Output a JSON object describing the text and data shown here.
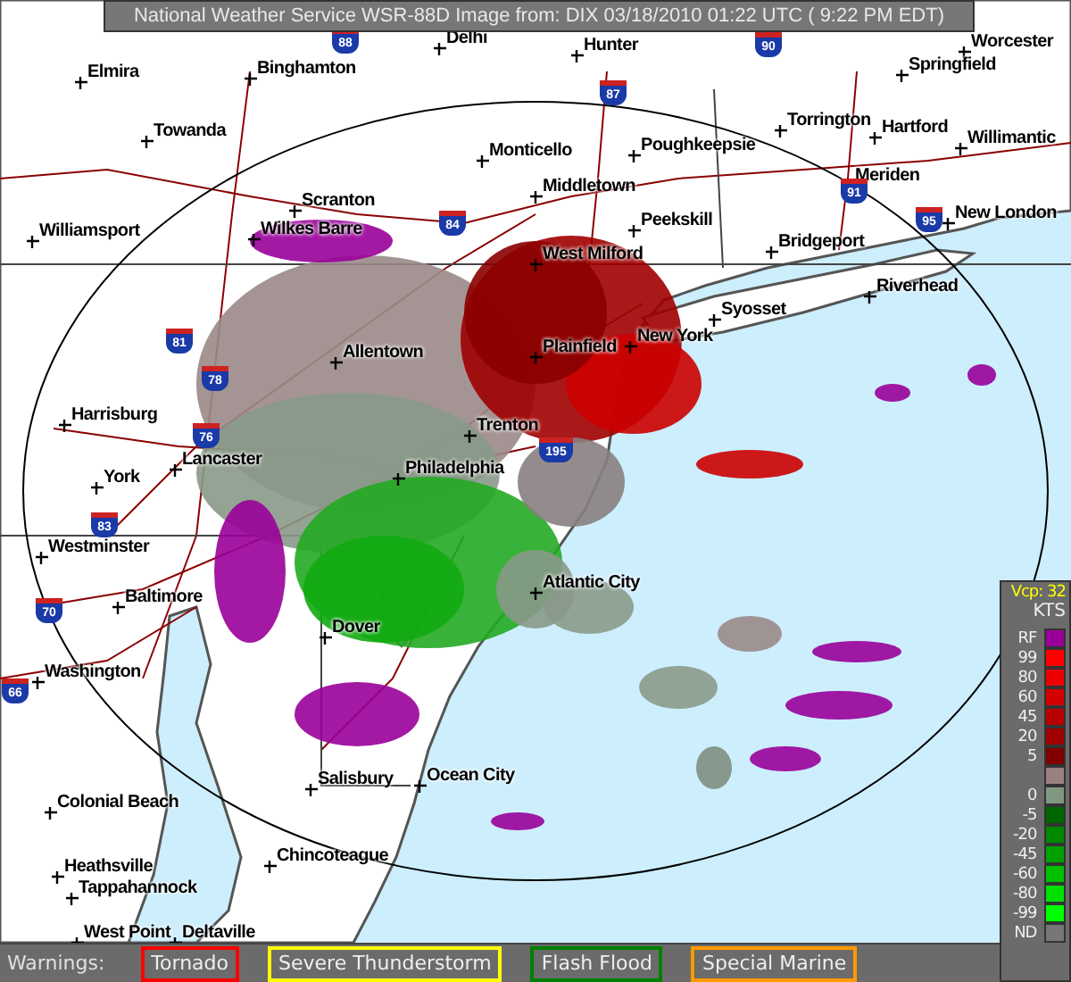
{
  "title_bar": {
    "text": "National Weather Service WSR-88D Image from: DIX 03/18/2010 01:22 UTC ( 9:22 PM EDT)"
  },
  "map": {
    "cities": [
      {
        "name": "Delhi"
      },
      {
        "name": "Hunter"
      },
      {
        "name": "Worcester"
      },
      {
        "name": "Elmira"
      },
      {
        "name": "Binghamton"
      },
      {
        "name": "Springfield"
      },
      {
        "name": "Towanda"
      },
      {
        "name": "Torrington"
      },
      {
        "name": "Hartford"
      },
      {
        "name": "Monticello"
      },
      {
        "name": "Poughkeepsie"
      },
      {
        "name": "Willimantic"
      },
      {
        "name": "Meriden"
      },
      {
        "name": "Middletown"
      },
      {
        "name": "Scranton"
      },
      {
        "name": "Peekskill"
      },
      {
        "name": "New London"
      },
      {
        "name": "Williamsport"
      },
      {
        "name": "Wilkes Barre"
      },
      {
        "name": "Bridgeport"
      },
      {
        "name": "West Milford"
      },
      {
        "name": "Riverhead"
      },
      {
        "name": "Syosset"
      },
      {
        "name": "Plainfield"
      },
      {
        "name": "New York"
      },
      {
        "name": "Allentown"
      },
      {
        "name": "Harrisburg"
      },
      {
        "name": "Trenton"
      },
      {
        "name": "Lancaster"
      },
      {
        "name": "York"
      },
      {
        "name": "Philadelphia"
      },
      {
        "name": "Westminster"
      },
      {
        "name": "Atlantic City"
      },
      {
        "name": "Baltimore"
      },
      {
        "name": "Dover"
      },
      {
        "name": "Washington"
      },
      {
        "name": "Salisbury"
      },
      {
        "name": "Ocean City"
      },
      {
        "name": "Colonial Beach"
      },
      {
        "name": "Chincoteague"
      },
      {
        "name": "Heathsville"
      },
      {
        "name": "Tappahannock"
      },
      {
        "name": "West Point"
      },
      {
        "name": "Deltaville"
      }
    ],
    "interstate_shields": [
      "88",
      "90",
      "87",
      "91",
      "84",
      "95",
      "81",
      "78",
      "76",
      "195",
      "83",
      "70",
      "66"
    ]
  },
  "legend": {
    "vcp": "Vcp: 32",
    "unit": "KTS",
    "items": [
      {
        "label": "RF",
        "color": "#990099"
      },
      {
        "label": "99",
        "color": "#ff0000"
      },
      {
        "label": "80",
        "color": "#ee0000"
      },
      {
        "label": "60",
        "color": "#d40000"
      },
      {
        "label": "45",
        "color": "#b80000"
      },
      {
        "label": "20",
        "color": "#a00000"
      },
      {
        "label": "5",
        "color": "#800000"
      },
      {
        "color": "#9a8080"
      },
      {
        "label": "0",
        "color": "#809880"
      },
      {
        "label": "-5",
        "color": "#006600"
      },
      {
        "label": "-20",
        "color": "#008800"
      },
      {
        "label": "-45",
        "color": "#00a000"
      },
      {
        "label": "-60",
        "color": "#00c000"
      },
      {
        "label": "-80",
        "color": "#00e000"
      },
      {
        "label": "-99",
        "color": "#00ff00"
      },
      {
        "label": "ND",
        "color": "#777777"
      }
    ]
  },
  "warnings": {
    "label": "Warnings:",
    "items": [
      {
        "label": "Tornado",
        "color": "#ff0000"
      },
      {
        "label": "Severe Thunderstorm",
        "color": "#ffff00"
      },
      {
        "label": "Flash Flood",
        "color": "#008000"
      },
      {
        "label": "Special Marine",
        "color": "#ff9900"
      }
    ]
  }
}
